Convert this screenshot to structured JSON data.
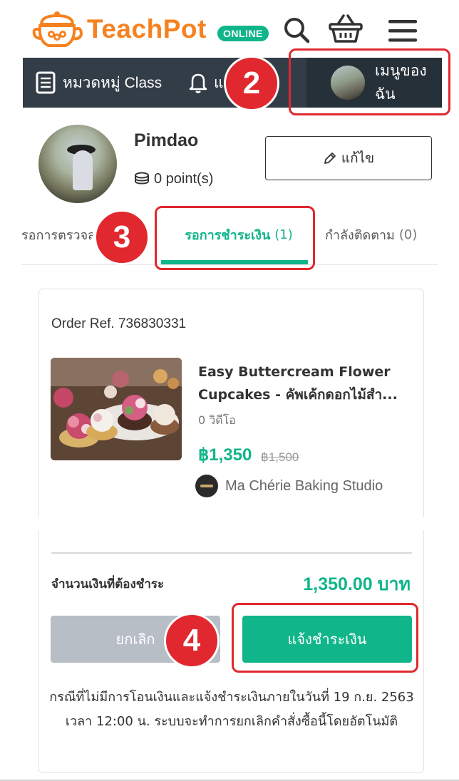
{
  "header": {
    "logo_text": "TeachPot",
    "badge": "ONLINE",
    "icons": [
      "teapot-logo-icon",
      "search-icon",
      "basket-icon",
      "hamburger-menu-icon"
    ]
  },
  "navbar": {
    "category_label": "หมวดหมู่ Class",
    "notification_label": "แจ้ง",
    "my_menu_label": "เมนูของฉัน"
  },
  "profile": {
    "name": "Pimdao",
    "points": "0 point(s)",
    "edit_label": "แก้ไข"
  },
  "tabs": [
    {
      "label": "รอการตรวจสอบ",
      "count": ""
    },
    {
      "label": "รอการชำระเงิน",
      "count": "(1)"
    },
    {
      "label": "กำลังติดตาม",
      "count": "(0)"
    }
  ],
  "order": {
    "ref_label": "Order Ref. 736830331",
    "title_line1": "Easy Buttercream Flower",
    "title_line2": "Cupcakes - คัพเค้กดอกไม้สำ...",
    "video_count": "0 วิดีโอ",
    "price": "฿1,350",
    "old_price": "฿1,500",
    "studio": "Ma Chérie Baking Studio"
  },
  "payment": {
    "amount_label": "จำนวนเงินที่ต้องชำระ",
    "amount_value": "1,350.00 บาท",
    "cancel_label": "ยกเลิก",
    "pay_label": "แจ้งชำระเงิน",
    "notice": "กรณีที่ไม่มีการโอนเงินและแจ้งชำระเงินภายในวันที่ 19 ก.ย. 2563 เวลา 12:00 น. ระบบจะทำการยกเลิกคำสั่งซื้อนี้โดยอัตโนมัติ"
  },
  "annotations": {
    "step2": "2",
    "step3": "3",
    "step4": "4"
  },
  "colors": {
    "brand_orange": "#f58220",
    "accent_green": "#11b58a",
    "navbar_bg": "#333d47",
    "annotation_red": "#e0282e",
    "cancel_gray": "#b8bec6"
  }
}
